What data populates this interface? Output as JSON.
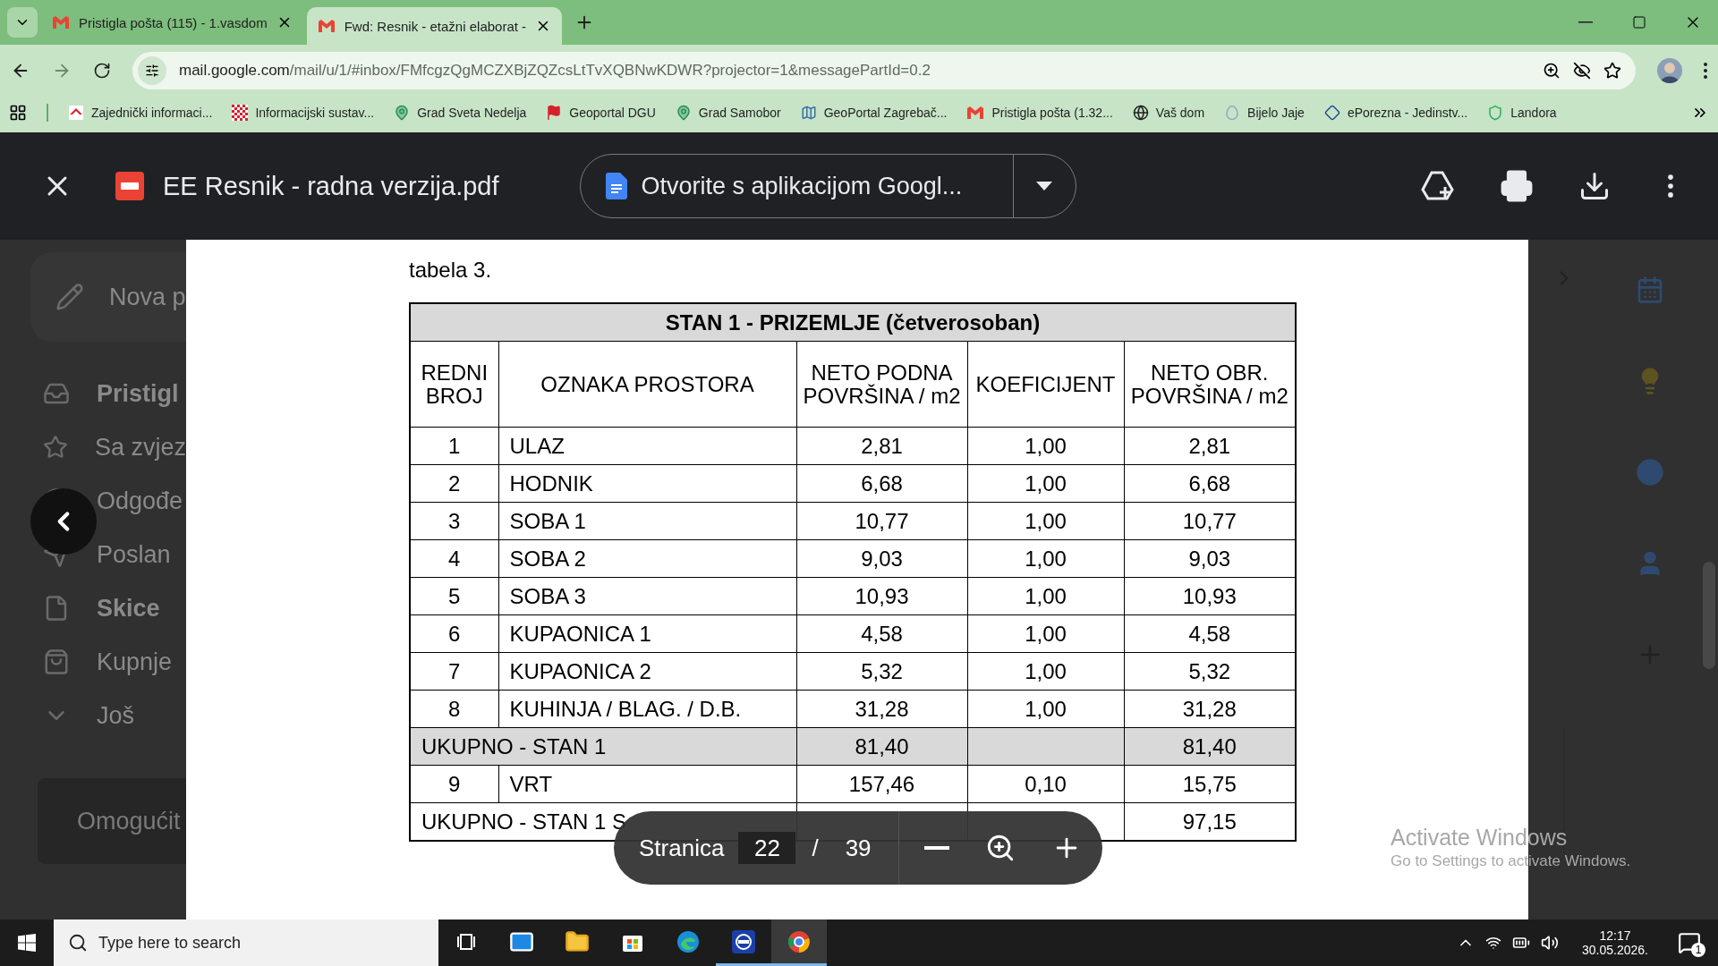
{
  "browser": {
    "tabs": [
      {
        "title": "Pristigla pošta (115) - 1.vasdom",
        "selected": false
      },
      {
        "title": "Fwd: Resnik - etažni elaborat -",
        "selected": true
      }
    ],
    "url": {
      "host": "mail.google.com",
      "path": "/mail/u/1/#inbox/FMfcgzQgMCZXBjZQZcsLtTvXQBNwKDWR?projector=1&messagePartId=0.2"
    },
    "bookmarks": [
      {
        "label": "Zajednički informaci...",
        "kind": "roof"
      },
      {
        "label": "Informacijski sustav...",
        "kind": "checker"
      },
      {
        "label": "Grad Sveta Nedelja",
        "kind": "pin"
      },
      {
        "label": "Geoportal DGU",
        "kind": "flag"
      },
      {
        "label": "Grad Samobor",
        "kind": "pin"
      },
      {
        "label": "GeoPortal Zagrebač...",
        "kind": "portal"
      },
      {
        "label": "Pristigla pošta (1.32...",
        "kind": "gmail"
      },
      {
        "label": "Vaš dom",
        "kind": "globe"
      },
      {
        "label": "Bijelo Jaje",
        "kind": "egg"
      },
      {
        "label": "ePorezna - Jedinstv...",
        "kind": "diamond"
      },
      {
        "label": "Landora",
        "kind": "shield"
      }
    ]
  },
  "mail_sidebar": {
    "compose": "Nova p",
    "items": [
      {
        "label": "Pristigl",
        "kind": "inbox",
        "unread": true
      },
      {
        "label": "Sa zvjez",
        "kind": "star",
        "unread": false
      },
      {
        "label": "Odgođe",
        "kind": "clock",
        "unread": false
      },
      {
        "label": "Poslan",
        "kind": "send",
        "unread": false
      },
      {
        "label": "Skice",
        "kind": "draft",
        "unread": true
      },
      {
        "label": "Kupnje",
        "kind": "bag",
        "unread": false
      },
      {
        "label": "Još",
        "kind": "more",
        "unread": false
      }
    ],
    "promo": "Omogućit"
  },
  "viewer": {
    "file_name": "EE Resnik - radna verzija.pdf",
    "open_with": "Otvorite s aplikacijom Googl...",
    "page_bar": {
      "label": "Stranica",
      "current": "22",
      "separator": "/",
      "total": "39"
    }
  },
  "document": {
    "caption": "tabela 3.",
    "table": {
      "title": "STAN 1 - PRIZEMLJE (četverosoban)",
      "columns": [
        "REDNI BROJ",
        "OZNAKA  PROSTORA",
        "NETO PODNA POVRŠINA / m2",
        "KOEFICIJENT",
        "NETO OBR. POVRŠINA / m2"
      ],
      "rows": [
        {
          "kind": "item",
          "no": "1",
          "name": "ULAZ",
          "net": "2,81",
          "coef": "1,00",
          "gross": "2,81"
        },
        {
          "kind": "item",
          "no": "2",
          "name": "HODNIK",
          "net": "6,68",
          "coef": "1,00",
          "gross": "6,68"
        },
        {
          "kind": "item",
          "no": "3",
          "name": "SOBA 1",
          "net": "10,77",
          "coef": "1,00",
          "gross": "10,77"
        },
        {
          "kind": "item",
          "no": "4",
          "name": "SOBA 2",
          "net": "9,03",
          "coef": "1,00",
          "gross": "9,03"
        },
        {
          "kind": "item",
          "no": "5",
          "name": "SOBA 3",
          "net": "10,93",
          "coef": "1,00",
          "gross": "10,93"
        },
        {
          "kind": "item",
          "no": "6",
          "name": "KUPAONICA 1",
          "net": "4,58",
          "coef": "1,00",
          "gross": "4,58"
        },
        {
          "kind": "item",
          "no": "7",
          "name": "KUPAONICA 2",
          "net": "5,32",
          "coef": "1,00",
          "gross": "5,32"
        },
        {
          "kind": "item",
          "no": "8",
          "name": "KUHINJA / BLAG. / D.B.",
          "net": "31,28",
          "coef": "1,00",
          "gross": "31,28"
        },
        {
          "kind": "total",
          "shaded": true,
          "label": "UKUPNO - STAN 1",
          "net": "81,40",
          "gross": "81,40"
        },
        {
          "kind": "item",
          "no": "9",
          "name": "VRT",
          "net": "157,46",
          "coef": "0,10",
          "gross": "15,75"
        },
        {
          "kind": "total",
          "shaded": false,
          "label": "UKUPNO - STAN 1 S",
          "gross": "97,15"
        }
      ]
    }
  },
  "windows_notice": {
    "title": "Activate Windows",
    "text": "Go to Settings to activate Windows."
  },
  "taskbar": {
    "search_placeholder": "Type here to search",
    "apps": [
      {
        "kind": "taskview",
        "running": false,
        "selected": false
      },
      {
        "kind": "mail",
        "running": false,
        "selected": false
      },
      {
        "kind": "folder",
        "running": false,
        "selected": false
      },
      {
        "kind": "store",
        "running": false,
        "selected": false
      },
      {
        "kind": "edge",
        "running": false,
        "selected": false
      },
      {
        "kind": "remote",
        "running": true,
        "selected": false
      },
      {
        "kind": "chrome",
        "running": true,
        "selected": true
      }
    ],
    "time": "12:17",
    "date": "30.05.2026.",
    "notifications": "1"
  }
}
